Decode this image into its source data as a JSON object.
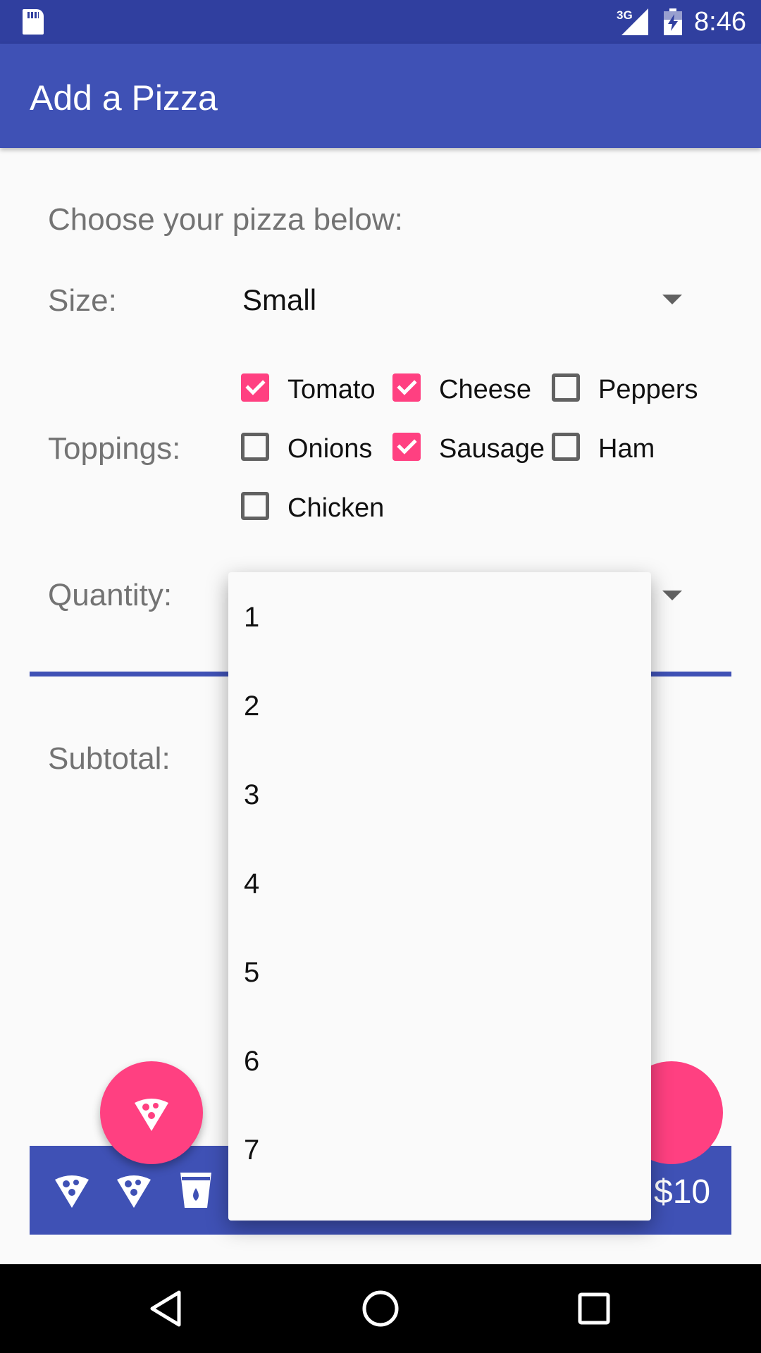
{
  "status_bar": {
    "network": "3G",
    "time": "8:46",
    "icons": [
      "sd-card-icon",
      "signal-icon",
      "battery-charging-icon"
    ]
  },
  "app_bar": {
    "title": "Add a Pizza"
  },
  "form": {
    "intro": "Choose your pizza below:",
    "size_label": "Size:",
    "size_value": "Small",
    "toppings_label": "Toppings:",
    "toppings": [
      {
        "label": "Tomato",
        "checked": true
      },
      {
        "label": "Cheese",
        "checked": true
      },
      {
        "label": "Peppers",
        "checked": false
      },
      {
        "label": "Onions",
        "checked": false
      },
      {
        "label": "Sausage",
        "checked": true
      },
      {
        "label": "Ham",
        "checked": false
      },
      {
        "label": "Chicken",
        "checked": false
      }
    ],
    "quantity_label": "Quantity:",
    "subtotal_label": "Subtotal:"
  },
  "dropdown": {
    "options": [
      "1",
      "2",
      "3",
      "4",
      "5",
      "6",
      "7"
    ]
  },
  "bottom_bar": {
    "icons": [
      "pizza-slice-icon",
      "pizza-slice-icon",
      "drink-cup-icon"
    ],
    "price": "$10"
  },
  "fab": {
    "icon": "pizza-slice-icon"
  },
  "colors": {
    "primary": "#3f51b5",
    "primary_dark": "#303f9f",
    "accent": "#ff4081"
  }
}
